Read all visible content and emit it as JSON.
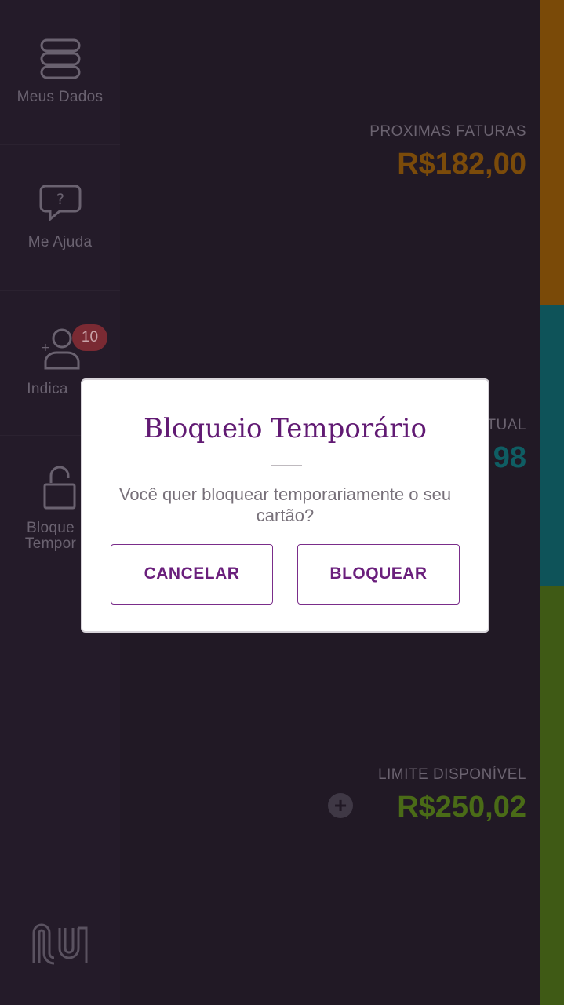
{
  "sidebar": {
    "items": [
      {
        "label": "Meus Dados",
        "icon": "database-icon"
      },
      {
        "label": "Me Ajuda",
        "icon": "help-chat-icon"
      },
      {
        "label": "Indica",
        "icon": "add-user-icon",
        "badge": "10"
      },
      {
        "label_line1": "Bloque",
        "label_line2": "Tempor",
        "icon": "unlock-icon"
      }
    ],
    "logo": "nu-logo"
  },
  "summary": {
    "next_invoices": {
      "label": "PROXIMAS FATURAS",
      "amount": "R$182,00"
    },
    "current_invoice": {
      "label": "TUAL",
      "amount": "98"
    },
    "available_limit": {
      "label": "LIMITE DISPONÍVEL",
      "amount": "R$250,02"
    }
  },
  "modal": {
    "title": "Bloqueio Temporário",
    "message": "Você quer bloquear temporariamente o seu cartão?",
    "cancel_label": "CANCELAR",
    "confirm_label": "BLOQUEAR"
  },
  "colors": {
    "orange": "#7a4a08",
    "teal": "#0e5359",
    "green": "#3f5a15",
    "accent_purple": "#611a73"
  }
}
